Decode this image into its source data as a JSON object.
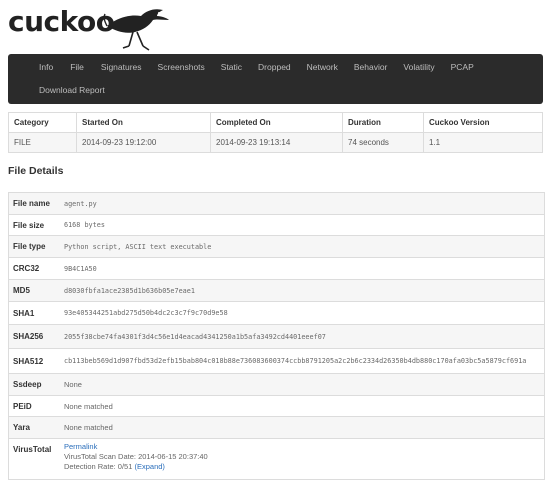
{
  "logo": {
    "text": "cuckoo"
  },
  "nav": {
    "row1": [
      "Info",
      "File",
      "Signatures",
      "Screenshots",
      "Static",
      "Dropped",
      "Network",
      "Behavior",
      "Volatility",
      "PCAP"
    ],
    "row2": [
      "Download Report"
    ]
  },
  "info_table": {
    "headers": [
      "Category",
      "Started On",
      "Completed On",
      "Duration",
      "Cuckoo Version"
    ],
    "row": [
      "FILE",
      "2014-09-23 19:12:00",
      "2014-09-23 19:13:14",
      "74 seconds",
      "1.1"
    ]
  },
  "file_details": {
    "title": "File Details",
    "rows": {
      "name": {
        "label": "File name",
        "value": "agent.py"
      },
      "size": {
        "label": "File size",
        "value": "6168 bytes"
      },
      "type": {
        "label": "File type",
        "value": "Python script, ASCII text executable"
      },
      "crc32": {
        "label": "CRC32",
        "value": "9B4C1A50"
      },
      "md5": {
        "label": "MD5",
        "value": "d8030fbfa1ace2385d1b636b05e7eae1"
      },
      "sha1": {
        "label": "SHA1",
        "value": "93e405344251abd275d50b4dc2c3c7f9c70d9e58"
      },
      "sha256": {
        "label": "SHA256",
        "value": "2055f38cbe74fa4301f3d4c56e1d4eacad4341250a1b5afa3492cd4401eeef07"
      },
      "sha512": {
        "label": "SHA512",
        "value": "cb113beb569d1d907fbd53d2efb15bab804c018b88e736083600374ccbb8791205a2c2b6c2334d26350b4db880c170afa03bc5a5879cf691a"
      },
      "ssdeep": {
        "label": "Ssdeep",
        "value": "None"
      },
      "peid": {
        "label": "PEiD",
        "value": "None matched"
      },
      "yara": {
        "label": "Yara",
        "value": "None matched"
      },
      "virustotal": {
        "label": "VirusTotal",
        "permalink": "Permalink",
        "scan_date": "VirusTotal Scan Date: 2014-06-15 20:37:40",
        "detection_prefix": "Detection Rate: 0/51",
        "expand": "(Expand)"
      }
    }
  },
  "colors": {
    "navbar_bg": "#2b2b2b",
    "nav_text": "#bdbdbd",
    "link": "#2a6ebb",
    "stripe": "#f6f6f6"
  }
}
